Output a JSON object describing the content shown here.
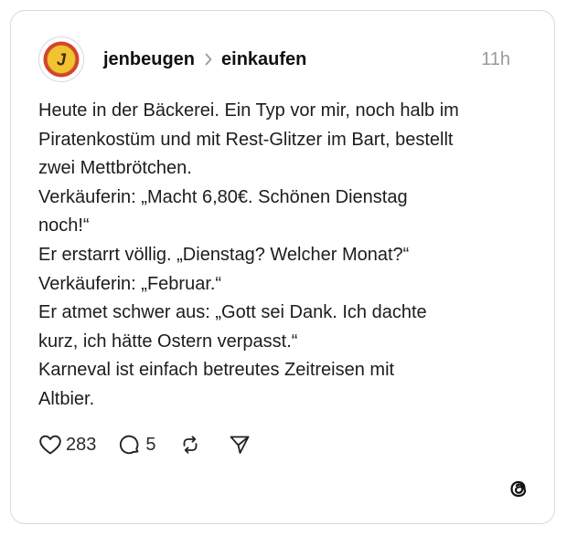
{
  "post": {
    "author": "jenbeugen",
    "community": "einkaufen",
    "time": "11h",
    "lines": [
      "Heute in der Bäckerei. Ein Typ vor mir, noch halb im",
      "Piratenkostüm und mit Rest-Glitzer im Bart, bestellt",
      "zwei Mettbrötchen.",
      "Verkäuferin: „Macht 6,80€. Schönen Dienstag",
      "noch!“",
      "Er erstarrt völlig. „Dienstag? Welcher Monat?“",
      "Verkäuferin: „Februar.“",
      "Er atmet schwer aus: „Gott sei Dank. Ich dachte",
      "kurz, ich hätte Ostern verpasst.“",
      "Karneval ist einfach betreutes Zeitreisen mit",
      "Altbier."
    ]
  },
  "avatar": {
    "letter": "J",
    "ring_color": "#d94030",
    "fill_color": "#f2c230"
  },
  "actions": {
    "likes": "283",
    "comments": "5"
  },
  "icons": {
    "like": "heart-icon",
    "comment": "comment-icon",
    "repost": "repost-icon",
    "share": "send-icon",
    "brand": "threads-logo-icon"
  }
}
